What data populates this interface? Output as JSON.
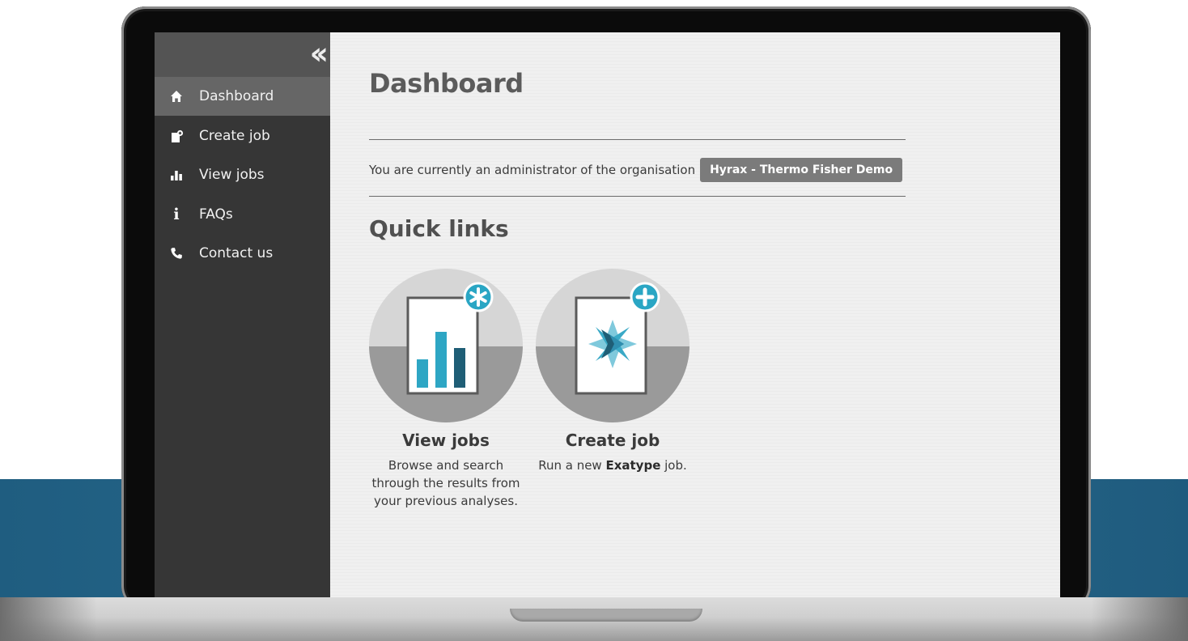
{
  "sidebar": {
    "collapse_icon": "double-chevron-left-icon",
    "items": [
      {
        "label": "Dashboard",
        "icon": "home-icon",
        "active": true
      },
      {
        "label": "Create job",
        "icon": "new-document-icon",
        "active": false
      },
      {
        "label": "View jobs",
        "icon": "bar-chart-icon",
        "active": false
      },
      {
        "label": "FAQs",
        "icon": "info-icon",
        "active": false
      },
      {
        "label": "Contact us",
        "icon": "phone-icon",
        "active": false
      }
    ]
  },
  "main": {
    "title": "Dashboard",
    "admin_text": "You are currently an administrator of the organisation",
    "organisation": "Hyrax - Thermo Fisher Demo",
    "quick_links_title": "Quick links",
    "quick_links": [
      {
        "title": "View jobs",
        "description": "Browse and search through the results from your previous analyses.",
        "icon": "report-chart-icon",
        "badge_icon": "asterisk-badge-icon"
      },
      {
        "title": "Create job",
        "description_prefix": "Run a new ",
        "description_bold": "Exatype",
        "description_suffix": " job.",
        "icon": "exatype-logo-icon",
        "badge_icon": "plus-badge-icon"
      }
    ]
  },
  "colors": {
    "sidebar_bg": "#363636",
    "sidebar_active": "#666666",
    "accent_teal": "#2aa6c4",
    "badge_bg": "#7b7b7b",
    "backdrop_blue": "#2b6d90"
  }
}
